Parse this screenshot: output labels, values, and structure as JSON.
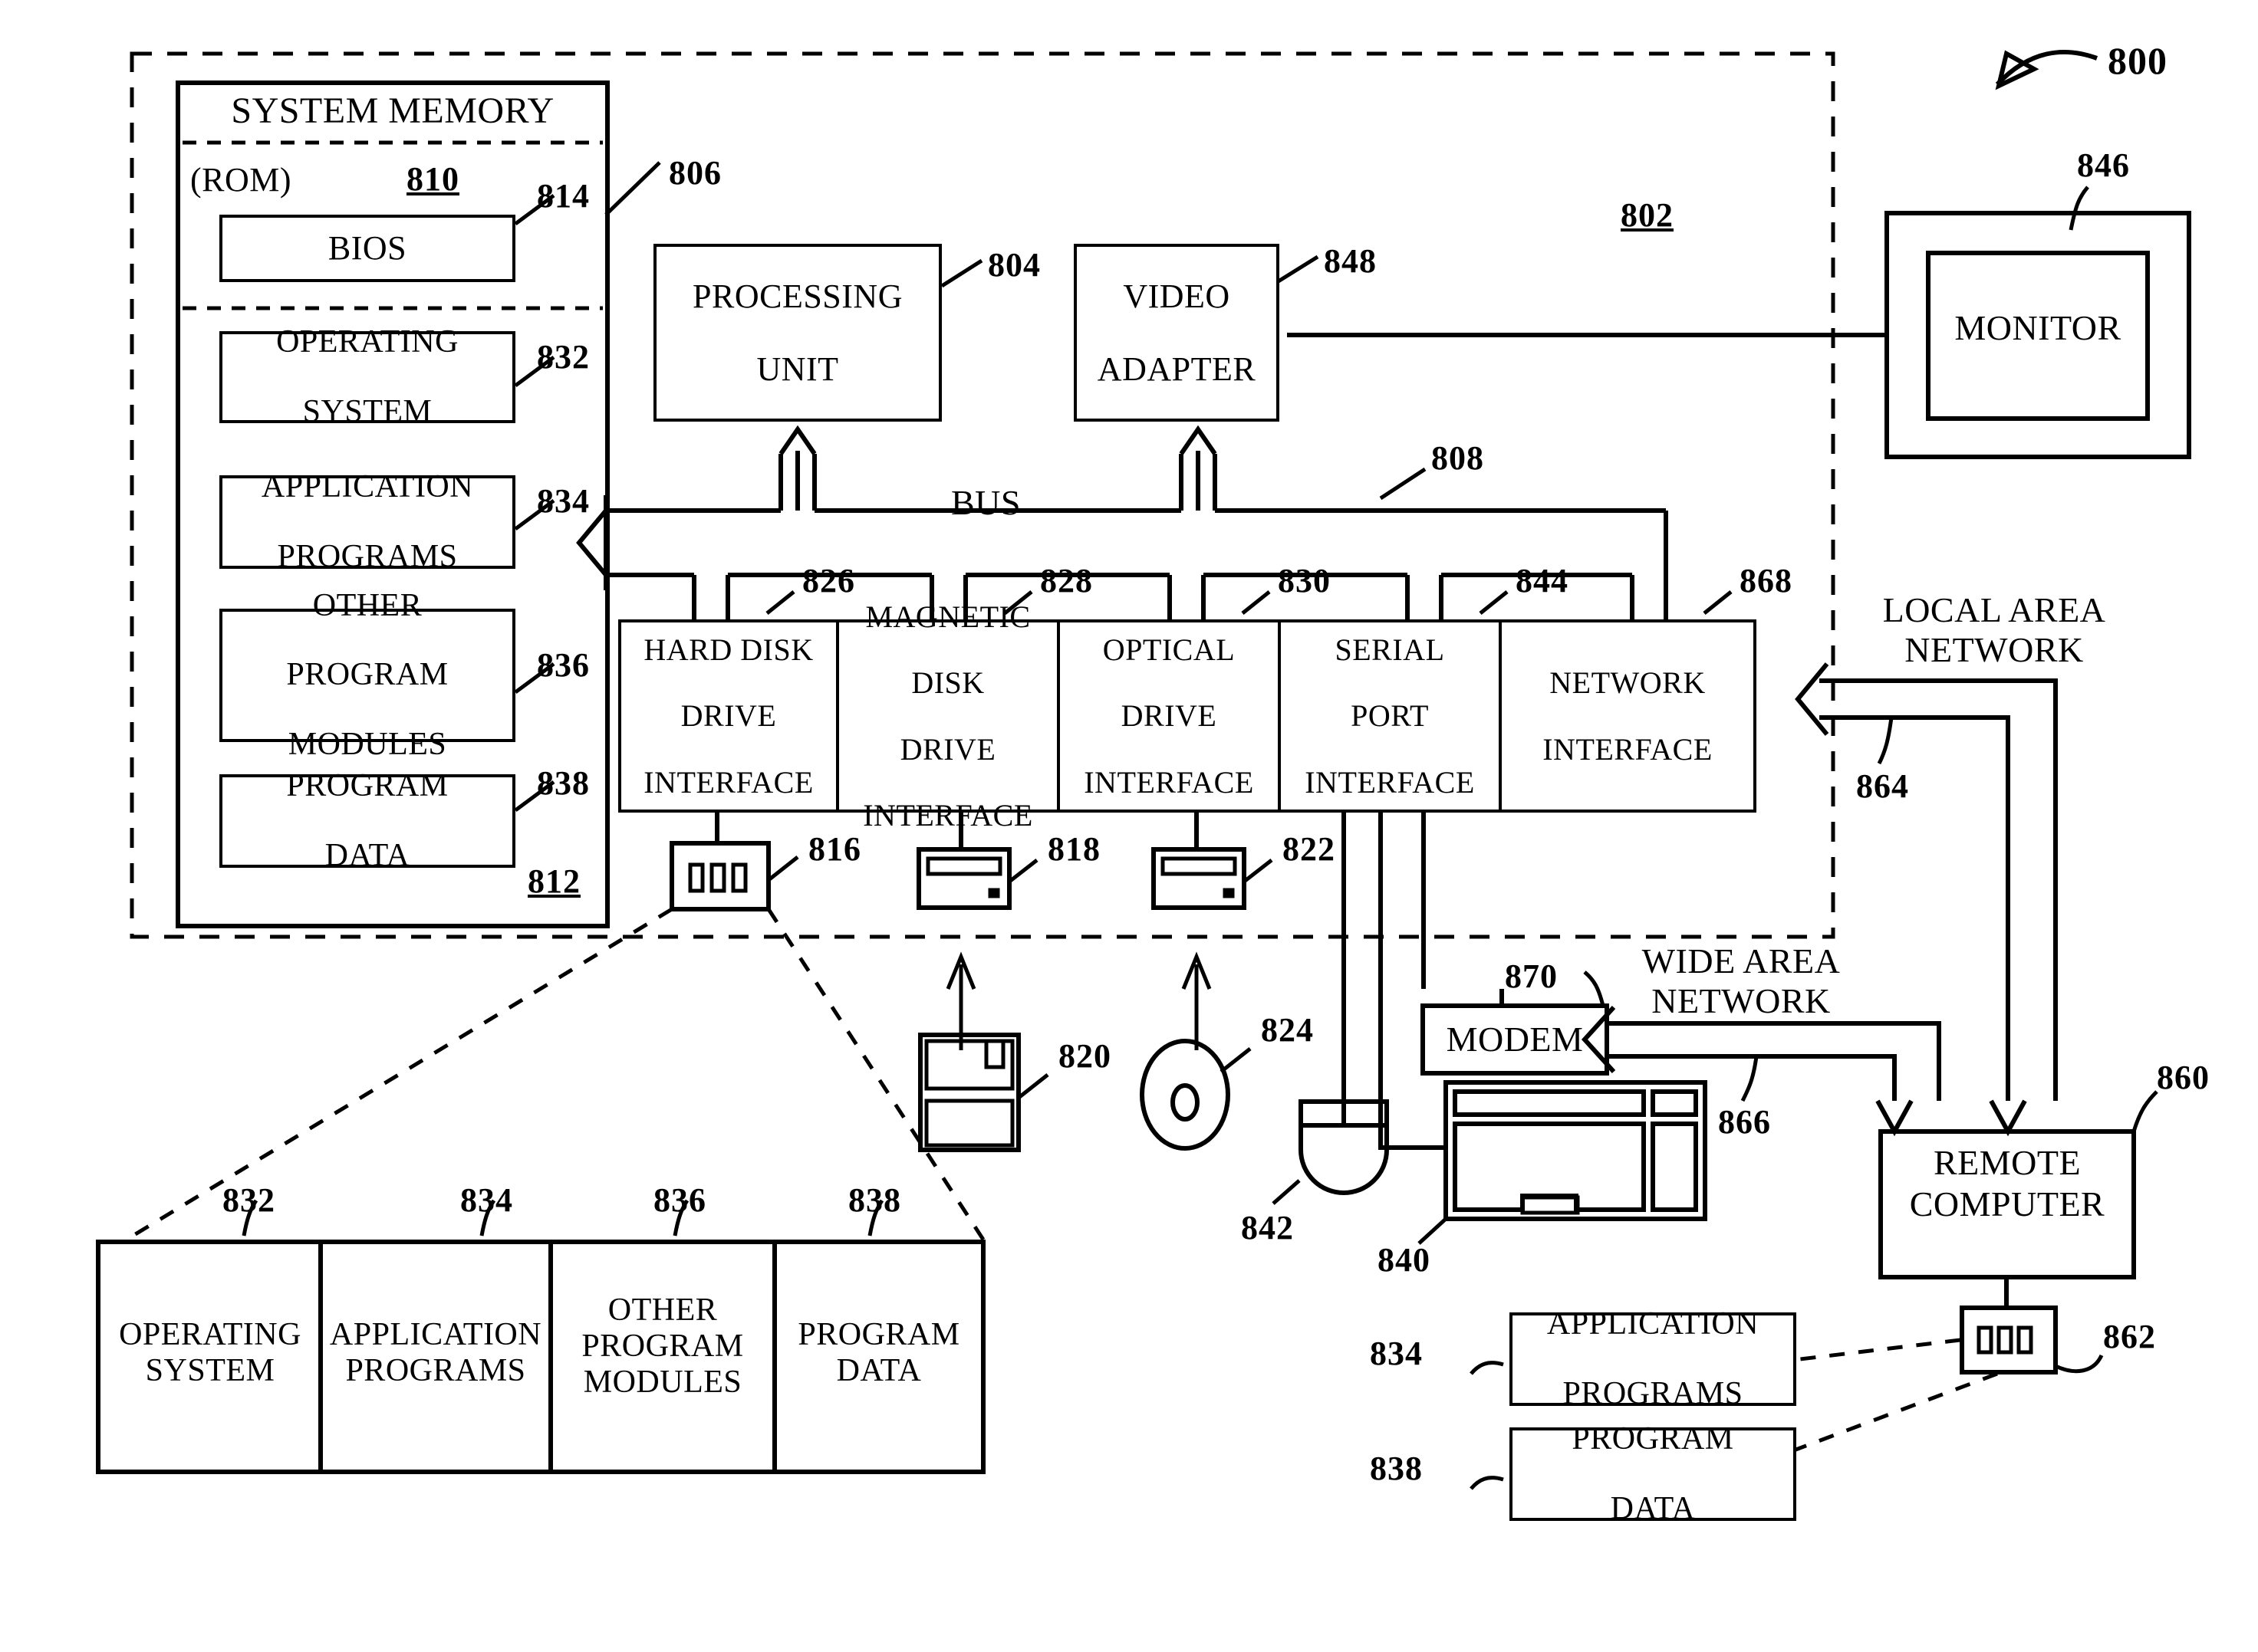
{
  "figure": {
    "number": "800",
    "system_ref": "802"
  },
  "memory": {
    "title": "SYSTEM MEMORY",
    "rom_label": "(ROM)",
    "rom_ref": "810",
    "ram_ref": "812",
    "bios": {
      "label": "BIOS",
      "ref": "814"
    },
    "items": [
      {
        "label": "OPERATING\nSYSTEM",
        "line1": "OPERATING",
        "line2": "SYSTEM",
        "ref": "832"
      },
      {
        "label": "APPLICATION PROGRAMS",
        "line1": "APPLICATION",
        "line2": "PROGRAMS",
        "ref": "834"
      },
      {
        "label": "OTHER PROGRAM MODULES",
        "line1": "OTHER",
        "line2": "PROGRAM",
        "line3": "MODULES",
        "ref": "836"
      },
      {
        "label": "PROGRAM DATA",
        "line1": "PROGRAM",
        "line2": "DATA",
        "ref": "838"
      }
    ],
    "outer_ref": "806"
  },
  "core": {
    "processing_unit": {
      "line1": "PROCESSING",
      "line2": "UNIT",
      "ref": "804"
    },
    "video_adapter": {
      "line1": "VIDEO",
      "line2": "ADAPTER",
      "ref": "848"
    },
    "bus": {
      "label": "BUS",
      "ref": "808"
    },
    "monitor": {
      "label": "MONITOR",
      "ref": "846"
    }
  },
  "interfaces": [
    {
      "line1": "HARD DISK",
      "line2": "DRIVE",
      "line3": "INTERFACE",
      "ref": "826"
    },
    {
      "line1": "MAGNETIC",
      "line2": "DISK",
      "line3": "DRIVE",
      "line4": "INTERFACE",
      "ref": "828"
    },
    {
      "line1": "OPTICAL",
      "line2": "DRIVE",
      "line3": "INTERFACE",
      "ref": "830"
    },
    {
      "line1": "SERIAL",
      "line2": "PORT",
      "line3": "INTERFACE",
      "ref": "844"
    },
    {
      "line1": "NETWORK",
      "line2": "INTERFACE",
      "ref": "868"
    }
  ],
  "devices": {
    "hard_disk_ref": "816",
    "magnetic_drive_ref": "818",
    "optical_drive_ref": "822",
    "floppy_disk_ref": "820",
    "optical_disc_ref": "824",
    "mouse_ref": "842",
    "keyboard_ref": "840"
  },
  "network": {
    "lan": {
      "line1": "LOCAL AREA",
      "line2": "NETWORK",
      "ref": "864"
    },
    "wan": {
      "line1": "WIDE AREA",
      "line2": "NETWORK",
      "ref": "866"
    },
    "modem": {
      "label": "MODEM",
      "ref": "870"
    },
    "remote_computer": {
      "line1": "REMOTE",
      "line2": "COMPUTER",
      "ref": "860"
    },
    "remote_storage_ref": "862"
  },
  "exploded": {
    "cells": [
      {
        "line1": "OPERATING",
        "line2": "SYSTEM",
        "ref": "832"
      },
      {
        "line1": "APPLICATION",
        "line2": "PROGRAMS",
        "ref": "834"
      },
      {
        "line1": "OTHER",
        "line2": "PROGRAM",
        "line3": "MODULES",
        "ref": "836"
      },
      {
        "line1": "PROGRAM",
        "line2": "DATA",
        "ref": "838"
      }
    ]
  },
  "remote_modules": [
    {
      "line1": "APPLICATION",
      "line2": "PROGRAMS",
      "ref": "834"
    },
    {
      "line1": "PROGRAM",
      "line2": "DATA",
      "ref": "838"
    }
  ]
}
